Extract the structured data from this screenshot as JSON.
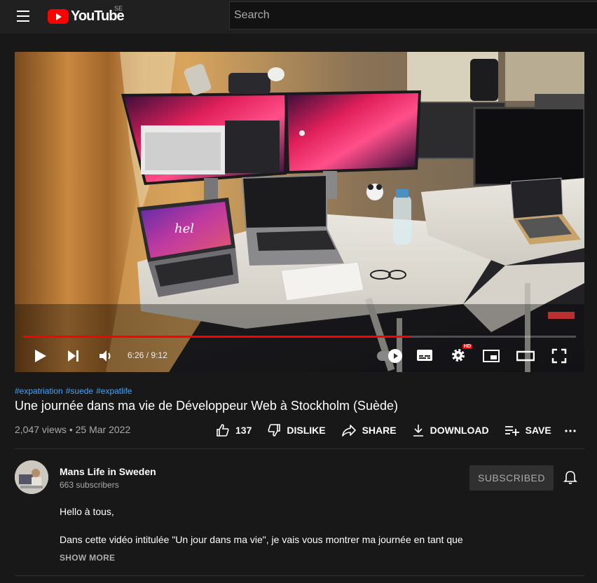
{
  "header": {
    "logo_text": "YouTube",
    "country_code": "SE",
    "search_placeholder": "Search"
  },
  "player": {
    "time_current": "6:26",
    "time_separator": "/",
    "time_total": "9:12",
    "progress_fraction": 0.699,
    "quality_badge": "HD",
    "screen_text": "hel"
  },
  "video": {
    "hashtags": [
      "#expatriation",
      "#suede",
      "#expatlife"
    ],
    "title": "Une journée dans ma vie de Développeur Web à Stockholm (Suède)",
    "views": "2,047 views",
    "date": "25 Mar 2022",
    "meta_separator": "•",
    "like_count": "137",
    "dislike_label": "DISLIKE",
    "share_label": "SHARE",
    "download_label": "DOWNLOAD",
    "save_label": "SAVE"
  },
  "channel": {
    "name": "Mans Life in Sweden",
    "subscribers": "663 subscribers",
    "subscribe_label": "SUBSCRIBED"
  },
  "description": {
    "line1": "Hello à tous,",
    "line2": "Dans cette vidéo intitulée \"Un jour dans ma vie\", je vais vous montrer ma journée en tant que",
    "show_more": "SHOW MORE"
  },
  "colors": {
    "brand_red": "#ff0000",
    "hashtag_blue": "#3ea6ff",
    "background": "#181818"
  }
}
